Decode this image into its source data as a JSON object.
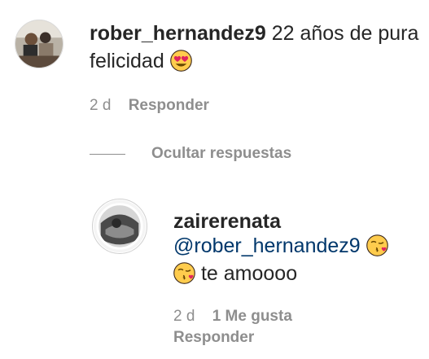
{
  "comment": {
    "username": "rober_hernandez9",
    "text": "22 años de pura felicidad",
    "emoji_icon": "heart-eyes-emoji-icon",
    "age": "2 d",
    "reply_label": "Responder"
  },
  "replies_toggle": {
    "label": "Ocultar respuestas"
  },
  "reply": {
    "username": "zairerenata",
    "mention": "@rober_hernandez9",
    "emoji_icon": "kissing-heart-emoji-icon",
    "text": "te amoooo",
    "age": "2 d",
    "likes_label": "1 Me gusta",
    "reply_label": "Responder"
  },
  "colors": {
    "text": "#262626",
    "muted": "#8e8e8e",
    "mention": "#00376b",
    "emoji_face": "#ffcc4d",
    "emoji_heart": "#e0245e"
  }
}
